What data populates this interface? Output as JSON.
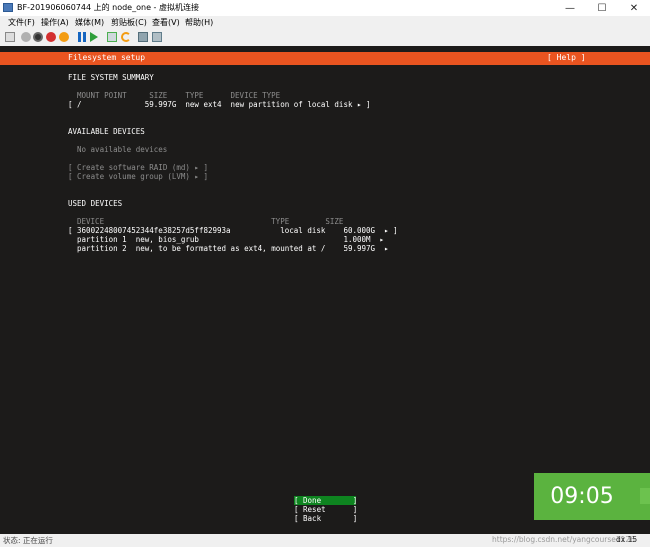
{
  "window": {
    "title": "BF-201906060744 上的 node_one - 虚拟机连接",
    "minimize": "—",
    "maximize": "☐",
    "close": "✕"
  },
  "menu": [
    "文件(F)",
    "操作(A)",
    "媒体(M)",
    "剪贴板(C)",
    "查看(V)",
    "帮助(H)"
  ],
  "vm": {
    "header": {
      "title": "Filesystem setup",
      "help": "[ Help ]"
    },
    "fs_summary": {
      "heading": "FILE SYSTEM SUMMARY",
      "columns": "MOUNT POINT     SIZE    TYPE      DEVICE TYPE",
      "row": "[ /              59.997G  new ext4  new partition of local disk ▸ ]"
    },
    "available": {
      "heading": "AVAILABLE DEVICES",
      "none": "No available devices",
      "raid": "[ Create software RAID (md) ▸ ]",
      "lvm": "[ Create volume group (LVM) ▸ ]"
    },
    "used": {
      "heading": "USED DEVICES",
      "columns": "DEVICE                                     TYPE        SIZE",
      "rows": [
        "[ 36002248007452344fe38257d5ff82993a           local disk    60.000G  ▸ ]",
        "  partition 1  new, bios_grub                                1.000M  ▸",
        "  partition 2  new, to be formatted as ext4, mounted at /    59.997G  ▸"
      ]
    },
    "buttons": {
      "done": "[ Done       ]",
      "reset": "[ Reset      ]",
      "back": "[ Back       ]"
    },
    "clock": "09:05"
  },
  "status": {
    "left": "状态: 正在运行",
    "watermark": "https://blog.csdn.net/yangcourse1126",
    "right": "dx  15"
  },
  "colors": {
    "header": "#e95420",
    "selected": "#0e8420",
    "clock": "#5bb33f"
  }
}
